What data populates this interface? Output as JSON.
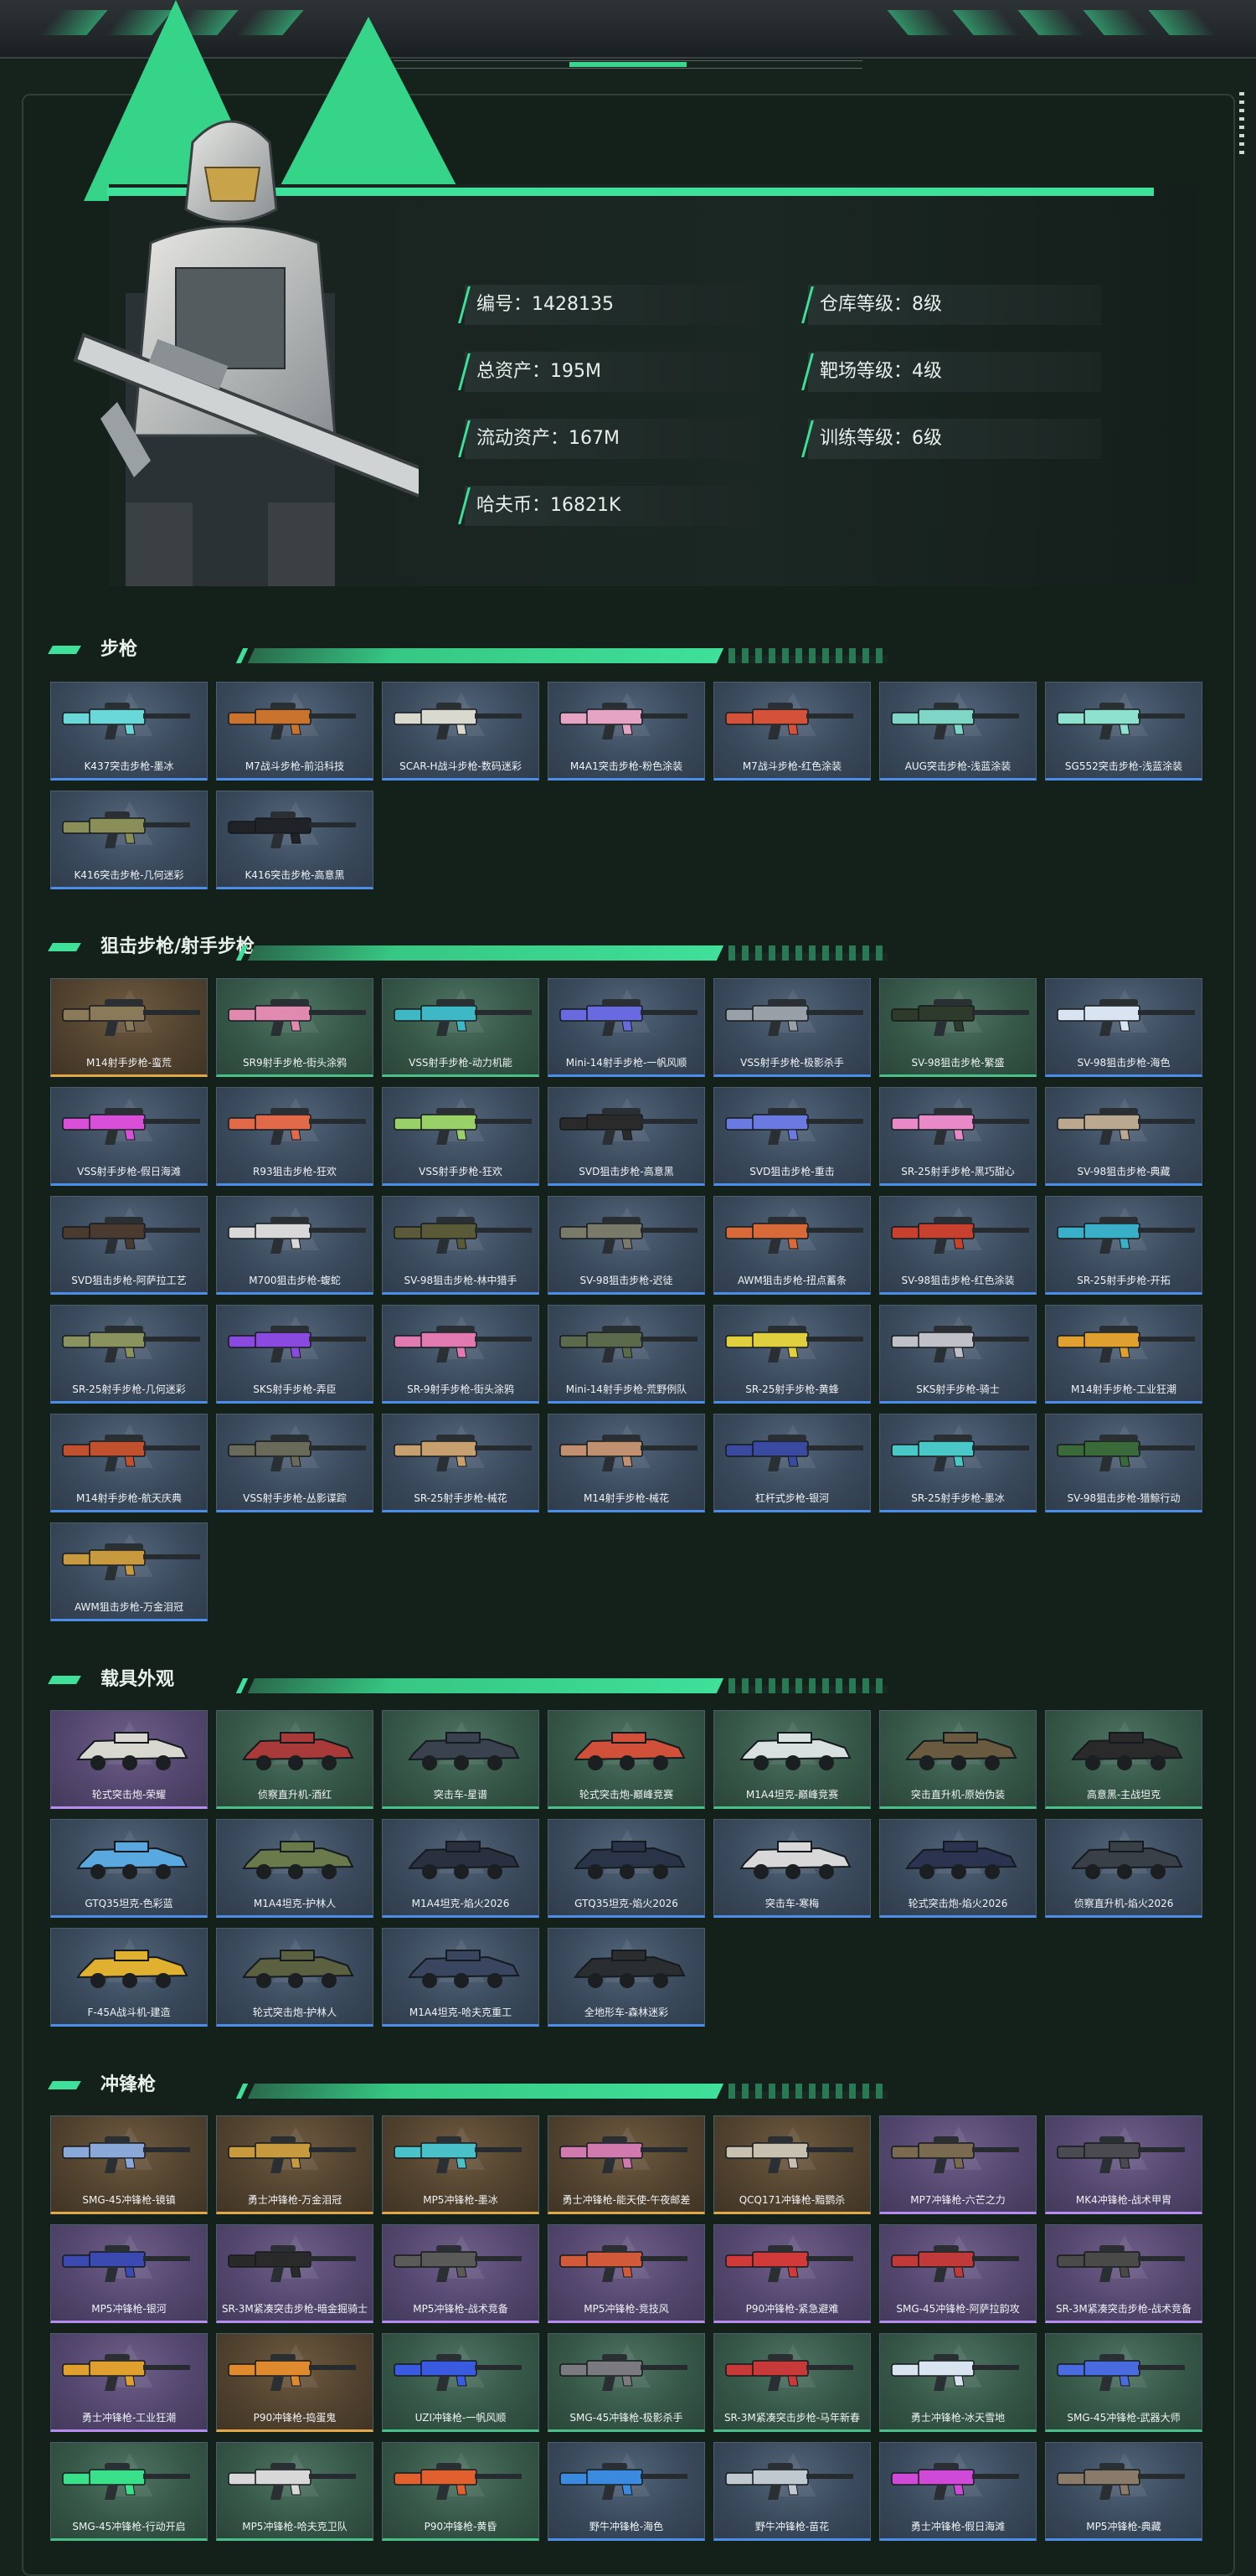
{
  "profile": {
    "stats": [
      {
        "label": "编号：",
        "value": "1428135"
      },
      {
        "label": "仓库等级：",
        "value": "8级"
      },
      {
        "label": "总资产：",
        "value": "195M"
      },
      {
        "label": "靶场等级：",
        "value": "4级"
      },
      {
        "label": "流动资产：",
        "value": "167M"
      },
      {
        "label": "训练等级：",
        "value": "6级"
      },
      {
        "label": "哈夫币：",
        "value": "16821K"
      }
    ]
  },
  "sections": {
    "rifles": {
      "title": "步枪",
      "items": [
        {
          "name": "K437突击步枪-墨冰",
          "color": "#6ad8d8",
          "tone": "blue"
        },
        {
          "name": "M7战斗步枪-前沿科技",
          "color": "#c9732e",
          "tone": "blue"
        },
        {
          "name": "SCAR-H战斗步枪-数码迷彩",
          "color": "#d9d9d0",
          "tone": "blue"
        },
        {
          "name": "M4A1突击步枪-粉色涂装",
          "color": "#e6a4c4",
          "tone": "blue"
        },
        {
          "name": "M7战斗步枪-红色涂装",
          "color": "#d4523a",
          "tone": "blue"
        },
        {
          "name": "AUG突击步枪-浅蓝涂装",
          "color": "#7fd6c6",
          "tone": "blue"
        },
        {
          "name": "SG552突击步枪-浅蓝涂装",
          "color": "#8ee0cf",
          "tone": "blue"
        },
        {
          "name": "K416突击步枪-几何迷彩",
          "color": "#8a8f5a",
          "tone": "blue"
        },
        {
          "name": "K416突击步枪-高意黑",
          "color": "#1f2226",
          "tone": "blue"
        }
      ]
    },
    "snipers": {
      "title": "狙击步枪/射手步枪",
      "items": [
        {
          "name": "M14射手步枪-蛮荒",
          "color": "#8b7a5a",
          "tone": "orange"
        },
        {
          "name": "SR9射手步枪-街头涂鸦",
          "color": "#e08ab0",
          "tone": "green"
        },
        {
          "name": "VSS射手步枪-动力机能",
          "color": "#3fb8c6",
          "tone": "green"
        },
        {
          "name": "Mini-14射手步枪-一帆风顺",
          "color": "#6a6ae0",
          "tone": "blue"
        },
        {
          "name": "VSS射手步枪-极影杀手",
          "color": "#9aa0a8",
          "tone": "blue"
        },
        {
          "name": "SV-98狙击步枪-繁盛",
          "color": "#2e3a2a",
          "tone": "green"
        },
        {
          "name": "SV-98狙击步枪-海色",
          "color": "#d8e4f2",
          "tone": "blue"
        },
        {
          "name": "VSS射手步枪-假日海滩",
          "color": "#d84fd8",
          "tone": "blue"
        },
        {
          "name": "R93狙击步枪-狂欢",
          "color": "#e06a4a",
          "tone": "blue"
        },
        {
          "name": "VSS射手步枪-狂欢",
          "color": "#9ad068",
          "tone": "blue"
        },
        {
          "name": "SVD狙击步枪-高意黑",
          "color": "#2a2a2a",
          "tone": "blue"
        },
        {
          "name": "SVD狙击步枪-重击",
          "color": "#6a7ae0",
          "tone": "blue"
        },
        {
          "name": "SR-25射手步枪-黑巧甜心",
          "color": "#e88ac8",
          "tone": "blue"
        },
        {
          "name": "SV-98狙击步枪-典藏",
          "color": "#bba890",
          "tone": "blue"
        },
        {
          "name": "SVD狙击步枪-阿萨拉工艺",
          "color": "#4a3a30",
          "tone": "blue"
        },
        {
          "name": "M700狙击步枪-蝮蛇",
          "color": "#d8d8d8",
          "tone": "blue"
        },
        {
          "name": "SV-98狙击步枪-林中猎手",
          "color": "#5a5a38",
          "tone": "blue"
        },
        {
          "name": "SV-98狙击步枪-迟徒",
          "color": "#7a7a6a",
          "tone": "blue"
        },
        {
          "name": "AWM狙击步枪-扭点蓄条",
          "color": "#d86a3a",
          "tone": "blue"
        },
        {
          "name": "SV-98狙击步枪-红色涂装",
          "color": "#c8402e",
          "tone": "blue"
        },
        {
          "name": "SR-25射手步枪-开拓",
          "color": "#3ab0c8",
          "tone": "blue"
        },
        {
          "name": "SR-25射手步枪-几何迷彩",
          "color": "#8a9260",
          "tone": "blue"
        },
        {
          "name": "SKS射手步枪-弄臣",
          "color": "#8a4ae0",
          "tone": "blue"
        },
        {
          "name": "SR-9射手步枪-街头涂鸦",
          "color": "#e07ab0",
          "tone": "blue"
        },
        {
          "name": "Mini-14射手步枪-荒野例队",
          "color": "#5a6a4a",
          "tone": "blue"
        },
        {
          "name": "SR-25射手步枪-黄蜂",
          "color": "#e0d040",
          "tone": "blue"
        },
        {
          "name": "SKS射手步枪-骑士",
          "color": "#c0c0c8",
          "tone": "blue"
        },
        {
          "name": "M14射手步枪-工业狂潮",
          "color": "#e0a030",
          "tone": "blue"
        },
        {
          "name": "M14射手步枪-航天庆典",
          "color": "#c0502e",
          "tone": "blue"
        },
        {
          "name": "VSS射手步枪-丛影谍踪",
          "color": "#6a6a5a",
          "tone": "blue"
        },
        {
          "name": "SR-25射手步枪-械花",
          "color": "#c8a070",
          "tone": "blue"
        },
        {
          "name": "M14射手步枪-械花",
          "color": "#c09070",
          "tone": "blue"
        },
        {
          "name": "杠杆式步枪-银河",
          "color": "#3a4aa0",
          "tone": "blue"
        },
        {
          "name": "SR-25射手步枪-墨冰",
          "color": "#4ac8c8",
          "tone": "blue"
        },
        {
          "name": "SV-98狙击步枪-猎鲸行动",
          "color": "#3a6a3a",
          "tone": "blue"
        },
        {
          "name": "AWM狙击步枪-万金泪冠",
          "color": "#c89a40",
          "tone": "blue"
        }
      ]
    },
    "vehicles": {
      "title": "载具外观",
      "items": [
        {
          "name": "轮式突击炮-荣耀",
          "color": "#d8d8d0",
          "tone": "purple"
        },
        {
          "name": "侦察直升机-酒红",
          "color": "#a83a3a",
          "tone": "green"
        },
        {
          "name": "突击车-星谱",
          "color": "#3a4250",
          "tone": "green"
        },
        {
          "name": "轮式突击炮-巅峰竞赛",
          "color": "#d0503a",
          "tone": "green"
        },
        {
          "name": "M1A4坦克-巅峰竞赛",
          "color": "#d8e0e0",
          "tone": "green"
        },
        {
          "name": "突击直升机-原始伪装",
          "color": "#6a5a40",
          "tone": "green"
        },
        {
          "name": "高意黑-主战坦克",
          "color": "#2a2a2a",
          "tone": "green"
        },
        {
          "name": "GTQ35坦克-色彩蓝",
          "color": "#5aa8e0",
          "tone": "blue"
        },
        {
          "name": "M1A4坦克-护林人",
          "color": "#6a7a4a",
          "tone": "blue"
        },
        {
          "name": "M1A4坦克-焰火2026",
          "color": "#2a3040",
          "tone": "blue"
        },
        {
          "name": "GTQ35坦克-焰火2026",
          "color": "#2a3448",
          "tone": "blue"
        },
        {
          "name": "突击车-寒梅",
          "color": "#d8d8d8",
          "tone": "blue"
        },
        {
          "name": "轮式突击炮-焰火2026",
          "color": "#2a3450",
          "tone": "blue"
        },
        {
          "name": "侦察直升机-焰火2026",
          "color": "#3a4048",
          "tone": "blue"
        },
        {
          "name": "F-45A战斗机-建造",
          "color": "#e0b030",
          "tone": "blue"
        },
        {
          "name": "轮式突击炮-护林人",
          "color": "#5a6040",
          "tone": "blue"
        },
        {
          "name": "M1A4坦克-哈夫克重工",
          "color": "#3a4660",
          "tone": "blue"
        },
        {
          "name": "全地形车-森林迷彩",
          "color": "#2a2e30",
          "tone": "blue"
        }
      ]
    },
    "smgs": {
      "title": "冲锋枪",
      "items": [
        {
          "name": "SMG-45冲锋枪-镜镇",
          "color": "#8aa8d8",
          "tone": "orange"
        },
        {
          "name": "勇士冲锋枪-万金泪冠",
          "color": "#c89a40",
          "tone": "orange"
        },
        {
          "name": "MP5冲锋枪-墨冰",
          "color": "#4ac0c8",
          "tone": "orange"
        },
        {
          "name": "勇士冲锋枪-能天使-午夜邮差",
          "color": "#d07ab0",
          "tone": "orange"
        },
        {
          "name": "QCQ171冲锋枪-黯鹦杀",
          "color": "#c8c0b0",
          "tone": "orange"
        },
        {
          "name": "MP7冲锋枪-六芒之力",
          "color": "#7a6a50",
          "tone": "purple"
        },
        {
          "name": "MK4冲锋枪-战术甲胄",
          "color": "#4a4a50",
          "tone": "purple"
        },
        {
          "name": "MP5冲锋枪-银河",
          "color": "#3a4ab0",
          "tone": "purple"
        },
        {
          "name": "SR-3M紧凑突击步枪-暗金掘骑士",
          "color": "#2a2a2a",
          "tone": "purple"
        },
        {
          "name": "MP5冲锋枪-战术竞备",
          "color": "#5a5a58",
          "tone": "purple"
        },
        {
          "name": "MP5冲锋枪-竞技风",
          "color": "#d05a3a",
          "tone": "purple"
        },
        {
          "name": "P90冲锋枪-紧急避难",
          "color": "#d03a3a",
          "tone": "purple"
        },
        {
          "name": "SMG-45冲锋枪-阿萨拉韵攻",
          "color": "#c03a3a",
          "tone": "purple"
        },
        {
          "name": "SR-3M紧凑突击步枪-战术竞备",
          "color": "#4a4a48",
          "tone": "purple"
        },
        {
          "name": "勇士冲锋枪-工业狂潮",
          "color": "#e0a030",
          "tone": "purple"
        },
        {
          "name": "P90冲锋枪-捣蛋鬼",
          "color": "#e08a30",
          "tone": "orange"
        },
        {
          "name": "UZI冲锋枪-一帆风顺",
          "color": "#3a5ae0",
          "tone": "green"
        },
        {
          "name": "SMG-45冲锋枪-极影杀手",
          "color": "#7a7a80",
          "tone": "green"
        },
        {
          "name": "SR-3M紧凑突击步枪-马年新春",
          "color": "#c83a3a",
          "tone": "green"
        },
        {
          "name": "勇士冲锋枪-冰天雪地",
          "color": "#d8e4f0",
          "tone": "green"
        },
        {
          "name": "SMG-45冲锋枪-武器大师",
          "color": "#4a6ae0",
          "tone": "green"
        },
        {
          "name": "SMG-45冲锋枪-行动开启",
          "color": "#3ae08a",
          "tone": "green"
        },
        {
          "name": "MP5冲锋枪-哈夫克卫队",
          "color": "#d8d8d8",
          "tone": "green"
        },
        {
          "name": "P90冲锋枪-黄昏",
          "color": "#e06030",
          "tone": "green"
        },
        {
          "name": "野牛冲锋枪-海色",
          "color": "#3a8ae0",
          "tone": "blue"
        },
        {
          "name": "野牛冲锋枪-苗花",
          "color": "#c0c8d0",
          "tone": "blue"
        },
        {
          "name": "勇士冲锋枪-假日海滩",
          "color": "#d04ad8",
          "tone": "blue"
        },
        {
          "name": "MP5冲锋枪-典藏",
          "color": "#8a7a6a",
          "tone": "blue"
        }
      ]
    }
  }
}
